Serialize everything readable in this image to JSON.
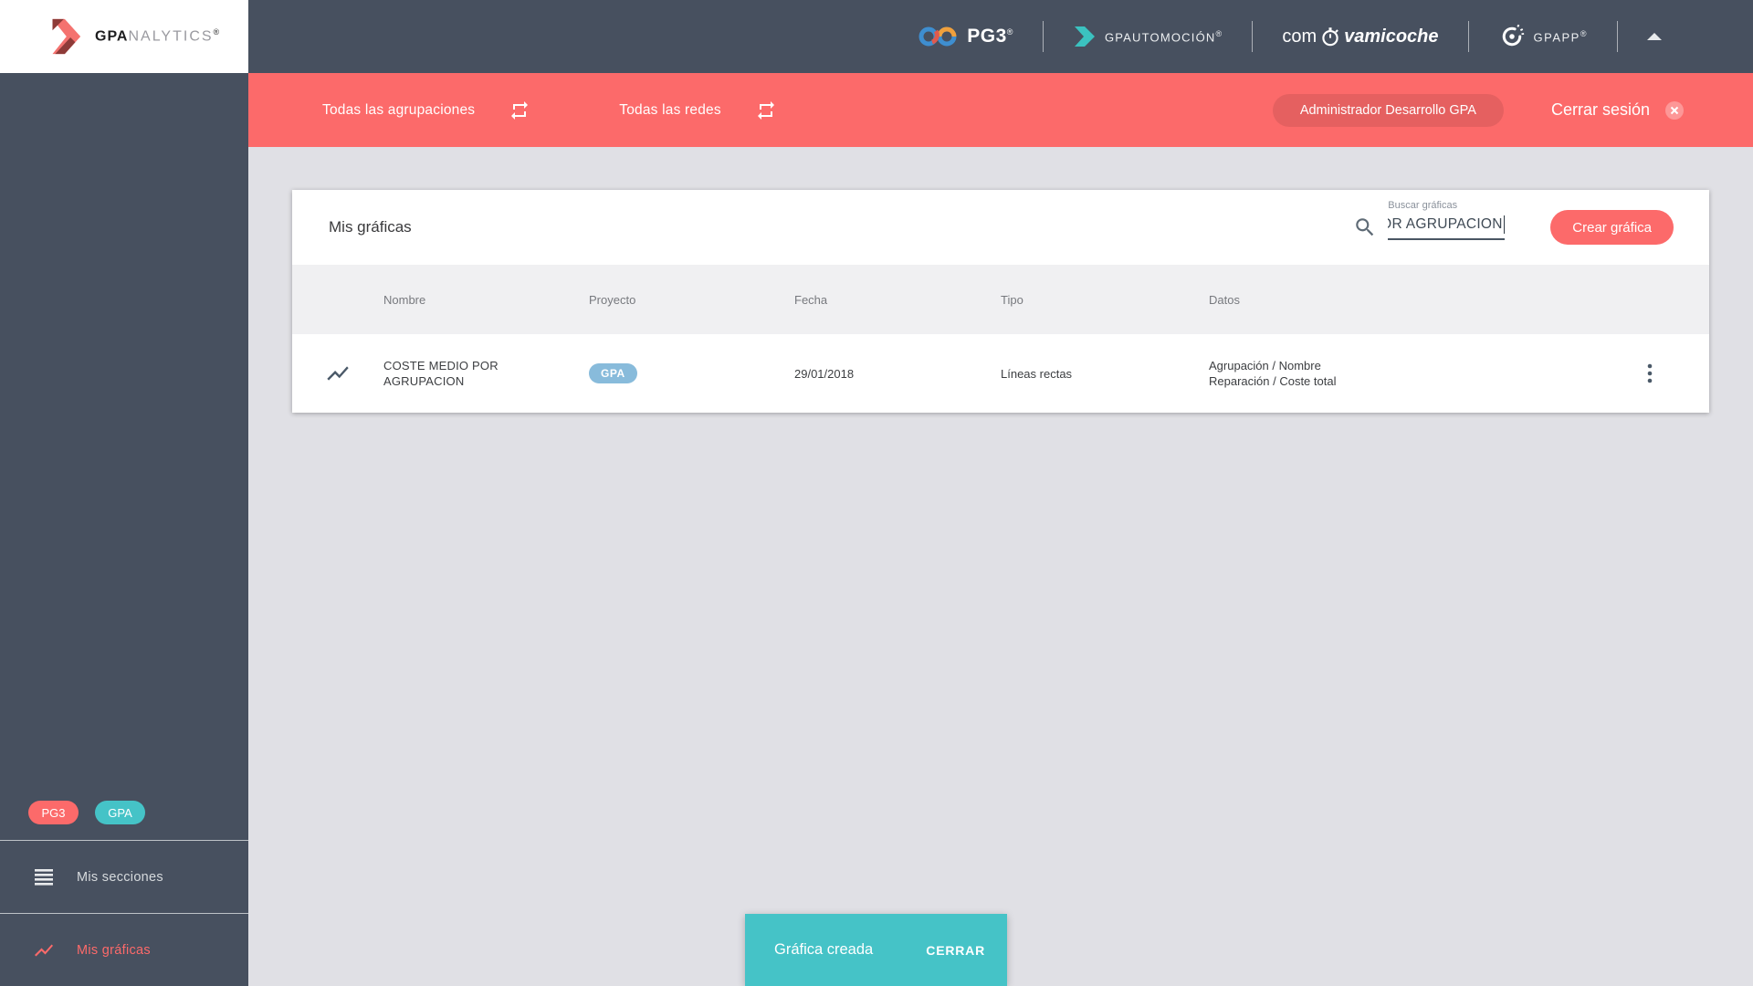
{
  "brand": {
    "bold": "GPA",
    "light": "NALYTICS",
    "reg": "®"
  },
  "topbar": {
    "pg3": {
      "label": "PG3",
      "reg": "®"
    },
    "automocion": {
      "label": "GPAUTOMOCIÓN",
      "reg": "®"
    },
    "comprova": {
      "prefix": "com",
      "suffix": "vamicoche"
    },
    "gpapp": {
      "label": "GPAPP",
      "reg": "®"
    }
  },
  "filterbar": {
    "agrupaciones_label": "Todas las agrupaciones",
    "redes_label": "Todas las redes",
    "user_label": "Administrador Desarrollo GPA",
    "logout_label": "Cerrar sesión"
  },
  "card": {
    "title": "Mis gráficas",
    "search_label": "Buscar gráficas",
    "search_value": "OR AGRUPACION",
    "create_button": "Crear gráfica"
  },
  "table": {
    "headers": [
      "Nombre",
      "Proyecto",
      "Fecha",
      "Tipo",
      "Datos"
    ],
    "rows": [
      {
        "name": "COSTE MEDIO POR AGRUPACION",
        "project": "GPA",
        "date": "29/01/2018",
        "type": "Líneas rectas",
        "data_lines": [
          "Agrupación / Nombre",
          "Reparación / Coste total"
        ]
      }
    ]
  },
  "sidebar": {
    "badges": [
      {
        "label": "PG3"
      },
      {
        "label": "GPA"
      }
    ],
    "items": [
      {
        "label": "Mis secciones",
        "active": false
      },
      {
        "label": "Mis gráficas",
        "active": true
      }
    ]
  },
  "toast": {
    "message": "Gráfica creada",
    "action": "CERRAR"
  },
  "colors": {
    "accent_red": "#FC6A6A",
    "accent_teal": "#45C3C7",
    "slate": "#47505F",
    "project_badge_blue": "#88BBDB",
    "page_background": "#E0E0E5"
  }
}
